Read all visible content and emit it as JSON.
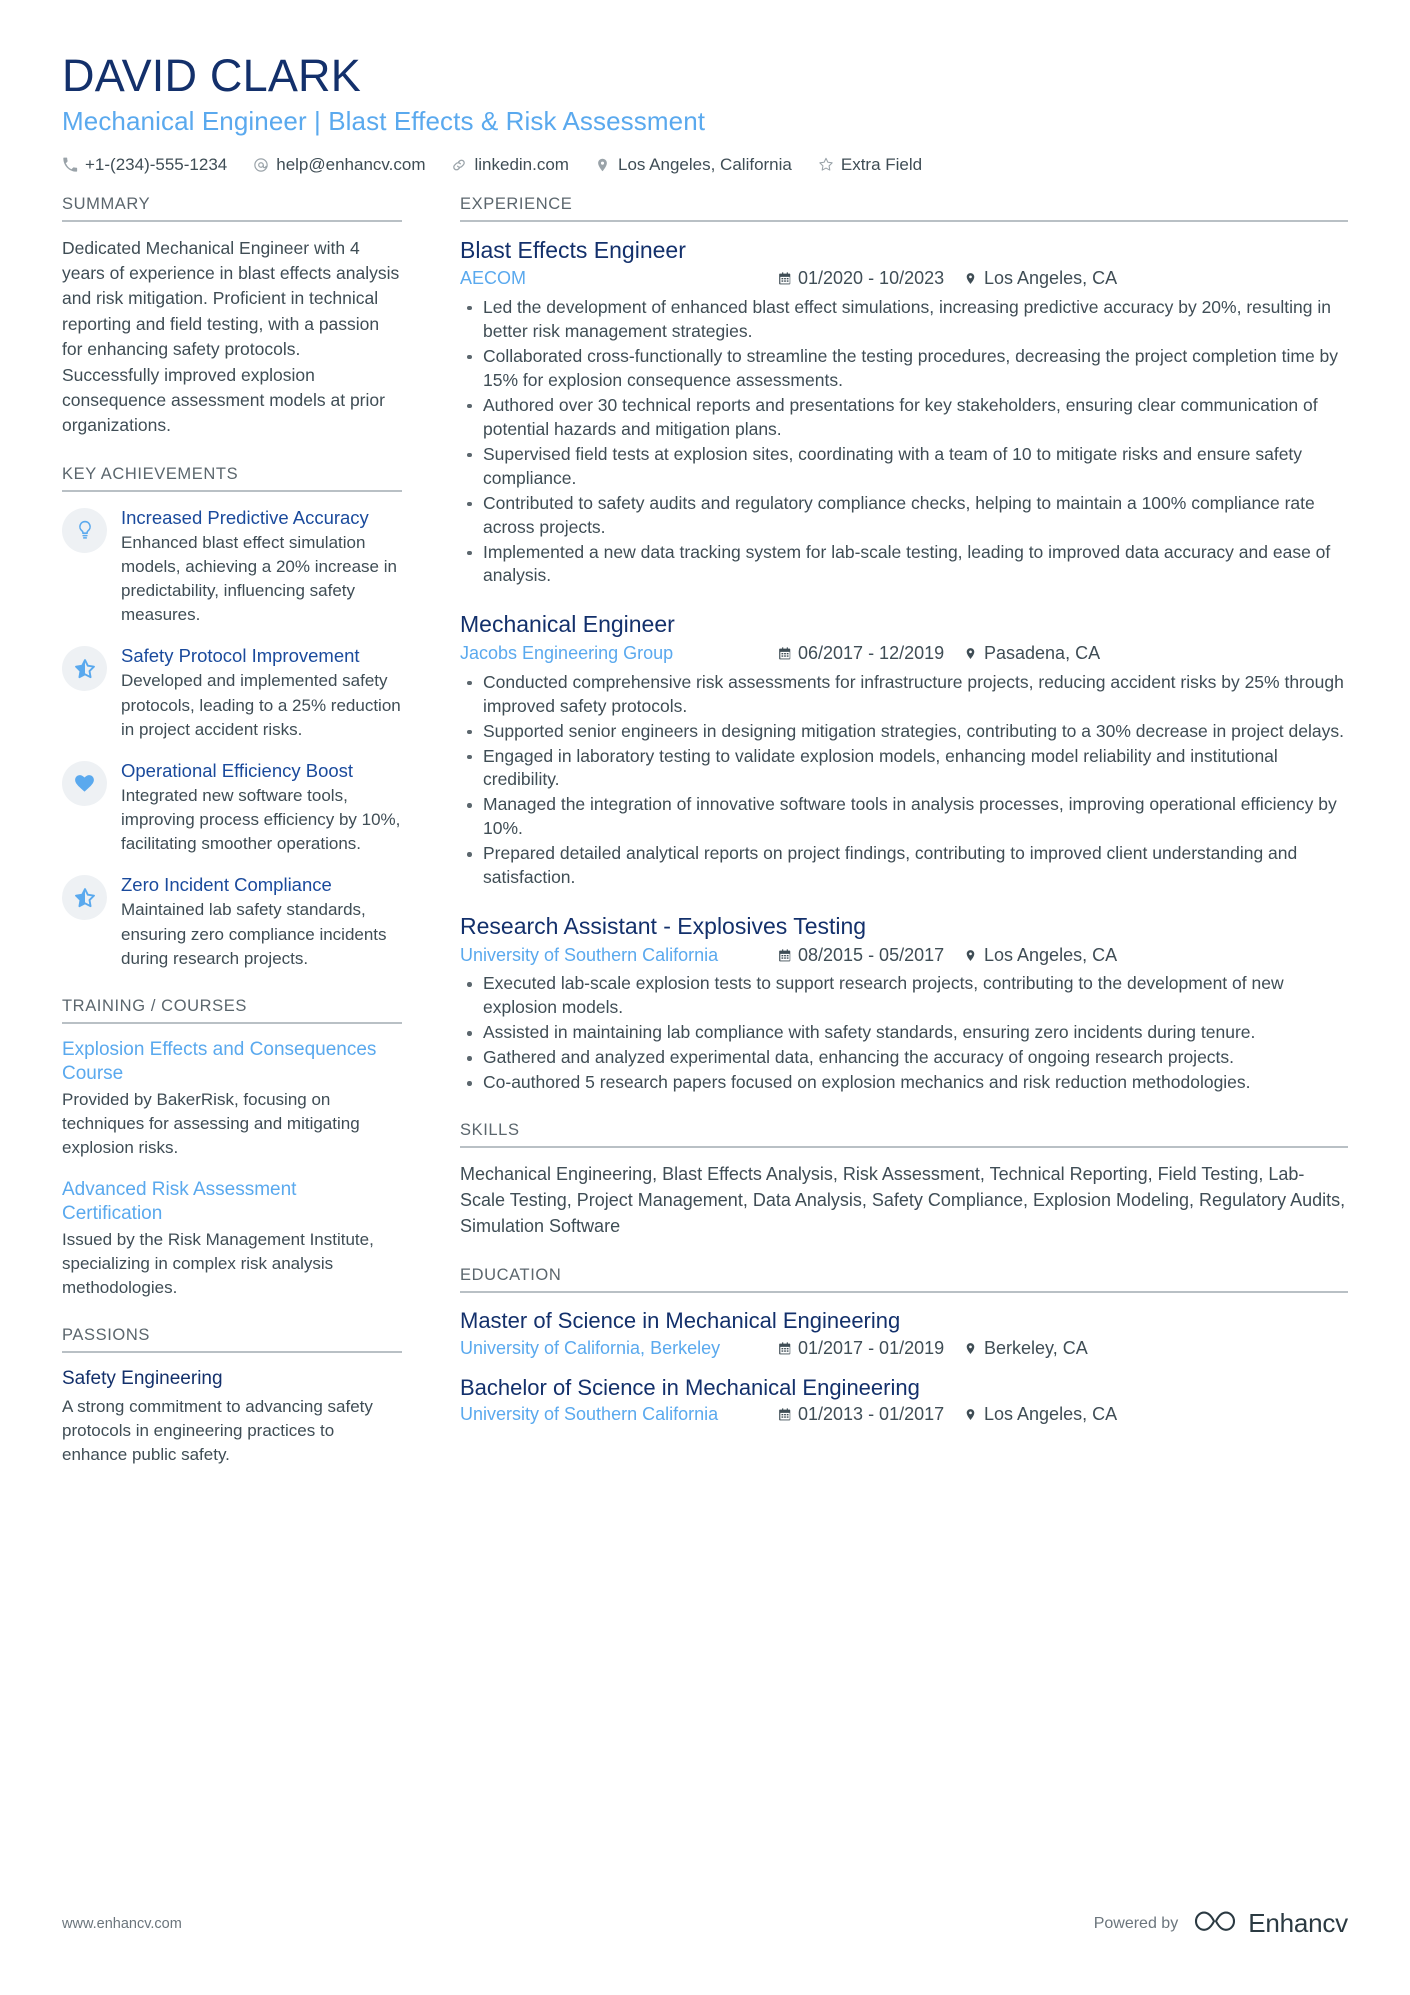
{
  "header": {
    "name": "DAVID CLARK",
    "headline": "Mechanical Engineer | Blast Effects & Risk Assessment",
    "contacts": [
      {
        "icon": "phone-icon",
        "text": "+1-(234)-555-1234"
      },
      {
        "icon": "email-icon",
        "text": "help@enhancv.com"
      },
      {
        "icon": "link-icon",
        "text": "linkedin.com"
      },
      {
        "icon": "location-pin-icon",
        "text": "Los Angeles, California"
      },
      {
        "icon": "star-outline-icon",
        "text": "Extra Field"
      }
    ]
  },
  "colors": {
    "name_navy": "#13306b",
    "accent_blue": "#5aa9ee",
    "heading_gray": "#5b666d",
    "body_gray": "#3f4d55",
    "link_blue": "#1a4a9c",
    "badge_bg": "#eef1f4"
  },
  "left": {
    "summary": {
      "title": "SUMMARY",
      "text": "Dedicated Mechanical Engineer with 4 years of experience in blast effects analysis and risk mitigation. Proficient in technical reporting and field testing, with a passion for enhancing safety protocols. Successfully improved explosion consequence assessment models at prior organizations."
    },
    "achievements": {
      "title": "KEY ACHIEVEMENTS",
      "items": [
        {
          "icon": "lightbulb-icon",
          "title": "Increased Predictive Accuracy",
          "desc": "Enhanced blast effect simulation models, achieving a 20% increase in predictability, influencing safety measures."
        },
        {
          "icon": "half-star-icon",
          "title": "Safety Protocol Improvement",
          "desc": "Developed and implemented safety protocols, leading to a 25% reduction in project accident risks."
        },
        {
          "icon": "heart-icon",
          "title": "Operational Efficiency Boost",
          "desc": "Integrated new software tools, improving process efficiency by 10%, facilitating smoother operations."
        },
        {
          "icon": "half-star-icon",
          "title": "Zero Incident Compliance",
          "desc": "Maintained lab safety standards, ensuring zero compliance incidents during research projects."
        }
      ]
    },
    "training": {
      "title": "TRAINING / COURSES",
      "items": [
        {
          "title": "Explosion Effects and Consequences Course",
          "desc": "Provided by BakerRisk, focusing on techniques for assessing and mitigating explosion risks."
        },
        {
          "title": "Advanced Risk Assessment Certification",
          "desc": "Issued by the Risk Management Institute, specializing in complex risk analysis methodologies."
        }
      ]
    },
    "passions": {
      "title": "PASSIONS",
      "items": [
        {
          "title": "Safety Engineering",
          "desc": "A strong commitment to advancing safety protocols in engineering practices to enhance public safety."
        }
      ]
    }
  },
  "right": {
    "experience": {
      "title": "EXPERIENCE",
      "jobs": [
        {
          "role": "Blast Effects Engineer",
          "company": "AECOM",
          "dates": "01/2020 - 10/2023",
          "location": "Los Angeles, CA",
          "bullets": [
            "Led the development of enhanced blast effect simulations, increasing predictive accuracy by 20%, resulting in better risk management strategies.",
            "Collaborated cross-functionally to streamline the testing procedures, decreasing the project completion time by 15% for explosion consequence assessments.",
            "Authored over 30 technical reports and presentations for key stakeholders, ensuring clear communication of potential hazards and mitigation plans.",
            "Supervised field tests at explosion sites, coordinating with a team of 10 to mitigate risks and ensure safety compliance.",
            "Contributed to safety audits and regulatory compliance checks, helping to maintain a 100% compliance rate across projects.",
            "Implemented a new data tracking system for lab-scale testing, leading to improved data accuracy and ease of analysis."
          ]
        },
        {
          "role": "Mechanical Engineer",
          "company": "Jacobs Engineering Group",
          "dates": "06/2017 - 12/2019",
          "location": "Pasadena, CA",
          "bullets": [
            "Conducted comprehensive risk assessments for infrastructure projects, reducing accident risks by 25% through improved safety protocols.",
            "Supported senior engineers in designing mitigation strategies, contributing to a 30% decrease in project delays.",
            "Engaged in laboratory testing to validate explosion models, enhancing model reliability and institutional credibility.",
            "Managed the integration of innovative software tools in analysis processes, improving operational efficiency by 10%.",
            "Prepared detailed analytical reports on project findings, contributing to improved client understanding and satisfaction."
          ]
        },
        {
          "role": "Research Assistant - Explosives Testing",
          "company": "University of Southern California",
          "dates": "08/2015 - 05/2017",
          "location": "Los Angeles, CA",
          "bullets": [
            "Executed lab-scale explosion tests to support research projects, contributing to the development of new explosion models.",
            "Assisted in maintaining lab compliance with safety standards, ensuring zero incidents during tenure.",
            "Gathered and analyzed experimental data, enhancing the accuracy of ongoing research projects.",
            "Co-authored 5 research papers focused on explosion mechanics and risk reduction methodologies."
          ]
        }
      ]
    },
    "skills": {
      "title": "SKILLS",
      "text": "Mechanical Engineering, Blast Effects Analysis, Risk Assessment, Technical Reporting, Field Testing, Lab-Scale Testing, Project Management, Data Analysis, Safety Compliance, Explosion Modeling, Regulatory Audits, Simulation Software"
    },
    "education": {
      "title": "EDUCATION",
      "items": [
        {
          "degree": "Master of Science in Mechanical Engineering",
          "school": "University of California, Berkeley",
          "dates": "01/2017 - 01/2019",
          "location": "Berkeley, CA"
        },
        {
          "degree": "Bachelor of Science in Mechanical Engineering",
          "school": "University of Southern California",
          "dates": "01/2013 - 01/2017",
          "location": "Los Angeles, CA"
        }
      ]
    }
  },
  "footer": {
    "url": "www.enhancv.com",
    "powered_by_label": "Powered by",
    "brand": "Enhancv"
  }
}
